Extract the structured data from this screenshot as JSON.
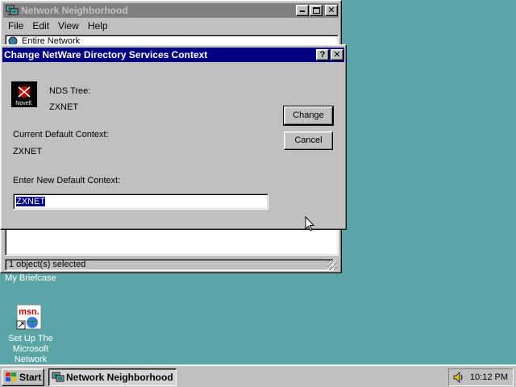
{
  "explorer": {
    "title": "Network Neighborhood",
    "menu": [
      "File",
      "Edit",
      "View",
      "Help"
    ],
    "address": "Entire Network",
    "status": "1 object(s) selected"
  },
  "dialog": {
    "title": "Change NetWare Directory Services Context",
    "logo_text": "Novell.",
    "nds_tree_label": "NDS Tree:",
    "nds_tree_value": "ZXNET",
    "current_context_label": "Current Default Context:",
    "current_context_value": "ZXNET",
    "new_context_label": "Enter New Default Context:",
    "new_context_value": "ZXNET",
    "change_button": "Change",
    "cancel_button": "Cancel",
    "help_glyph": "?",
    "close_glyph": "✕"
  },
  "desktop": {
    "briefcase_label": "My Briefcase",
    "msn_label_lines": [
      "Set Up The",
      "Microsoft",
      "Network"
    ],
    "msn_logo_text": "msn."
  },
  "taskbar": {
    "start_label": "Start",
    "task_label": "Network Neighborhood",
    "clock": "10:12 PM"
  },
  "colors": {
    "desktop": "#5aa6a6",
    "active_title": "#000080",
    "inactive_title": "#808080",
    "face": "#c0c0c0"
  }
}
